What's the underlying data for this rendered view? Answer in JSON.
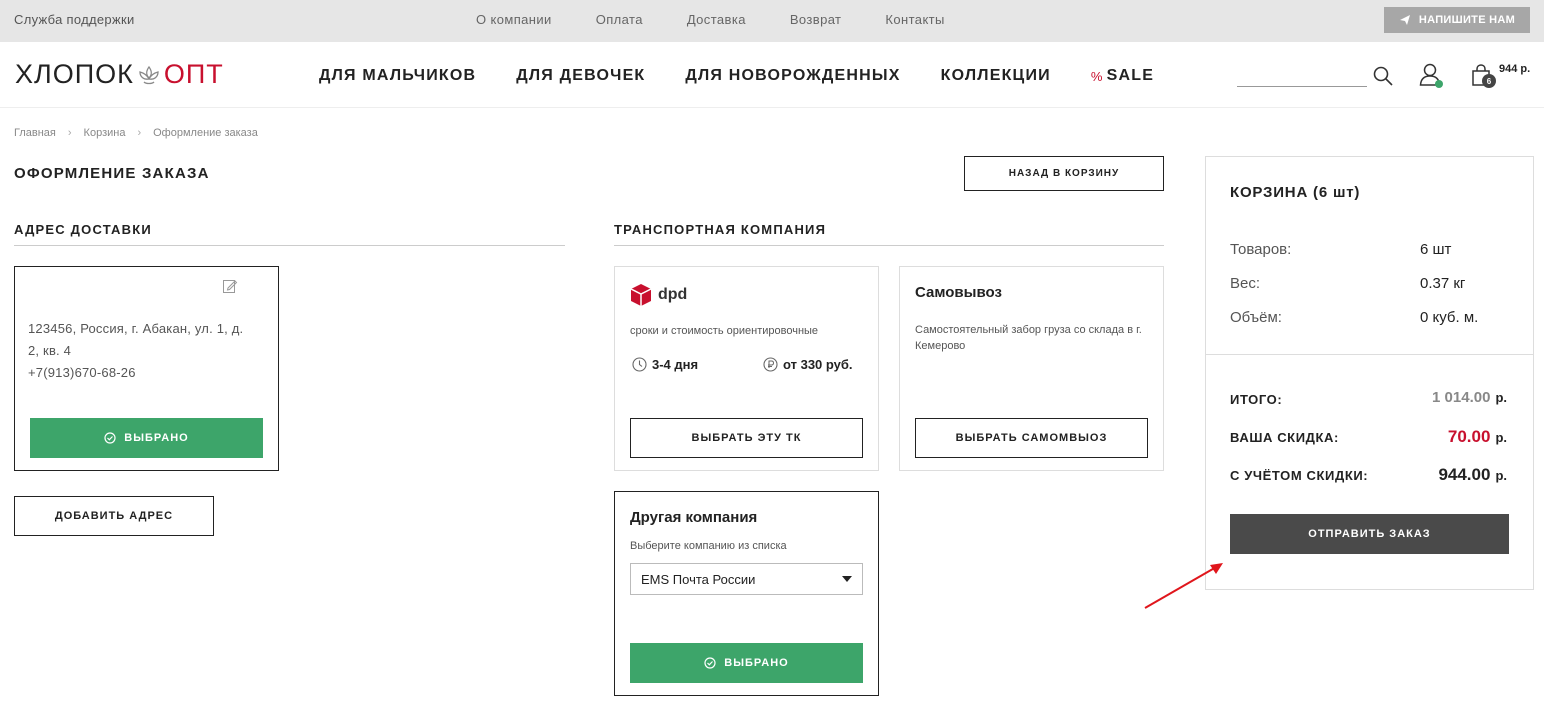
{
  "topbar": {
    "support": "Служба поддержки",
    "links": [
      "О компании",
      "Оплата",
      "Доставка",
      "Возврат",
      "Контакты"
    ],
    "write_button": "НАПИШИТЕ НАМ"
  },
  "header": {
    "logo_left": "ХЛОПОК",
    "logo_right": "ОПТ",
    "nav": [
      "ДЛЯ МАЛЬЧИКОВ",
      "ДЛЯ ДЕВОЧЕК",
      "ДЛЯ НОВОРОЖДЕННЫХ",
      "КОЛЛЕКЦИИ"
    ],
    "sale_pct": "%",
    "sale_label": "SALE",
    "search_value": "",
    "cart_count": "6",
    "cart_sum": "944 р."
  },
  "breadcrumb": [
    "Главная",
    "Корзина",
    "Оформление заказа"
  ],
  "page_title": "ОФОРМЛЕНИЕ ЗАКАЗА",
  "back_button": "НАЗАД В КОРЗИНУ",
  "address": {
    "section_title": "АДРЕС ДОСТАВКИ",
    "line1": "123456, Россия, г. Абакан, ул. 1, д.",
    "line2": "2, кв. 4",
    "phone": "+7(913)670-68-26",
    "selected_label": "ВЫБРАНО",
    "add_button": "ДОБАВИТЬ АДРЕС"
  },
  "transport": {
    "section_title": "ТРАНСПОРТНАЯ КОМПАНИЯ",
    "dpd": {
      "name": "dpd",
      "desc": "сроки и стоимость ориентировочные",
      "days": "3-4 дня",
      "price": "от 330 руб.",
      "button": "ВЫБРАТЬ ЭТУ ТК"
    },
    "pickup": {
      "name": "Самовывоз",
      "desc": "Самостоятельный забор груза со склада в г. Кемерово",
      "button": "ВЫБРАТЬ САМОМВЫОЗ"
    },
    "other": {
      "name": "Другая компания",
      "desc": "Выберите компанию из списка",
      "selected_option": "EMS Почта России",
      "selected_label": "ВЫБРАНО"
    }
  },
  "summary": {
    "title": "КОРЗИНА (6 шт)",
    "rows": [
      {
        "label": "Товаров:",
        "value": "6 шт"
      },
      {
        "label": "Вес:",
        "value": "0.37 кг"
      },
      {
        "label": "Объём:",
        "value": "0 куб. м."
      }
    ],
    "total_label": "ИТОГО:",
    "total_value": "1 014.00",
    "discount_label": "ВАША СКИДКА:",
    "discount_value": "70.00",
    "final_label": "С УЧЁТОМ СКИДКИ:",
    "final_value": "944.00",
    "currency": "р.",
    "send_button": "ОТПРАВИТЬ ЗАКАЗ"
  },
  "colors": {
    "accent_green": "#3da56a",
    "brand_red": "#c8102e",
    "dark_button": "#4a4a4a"
  }
}
